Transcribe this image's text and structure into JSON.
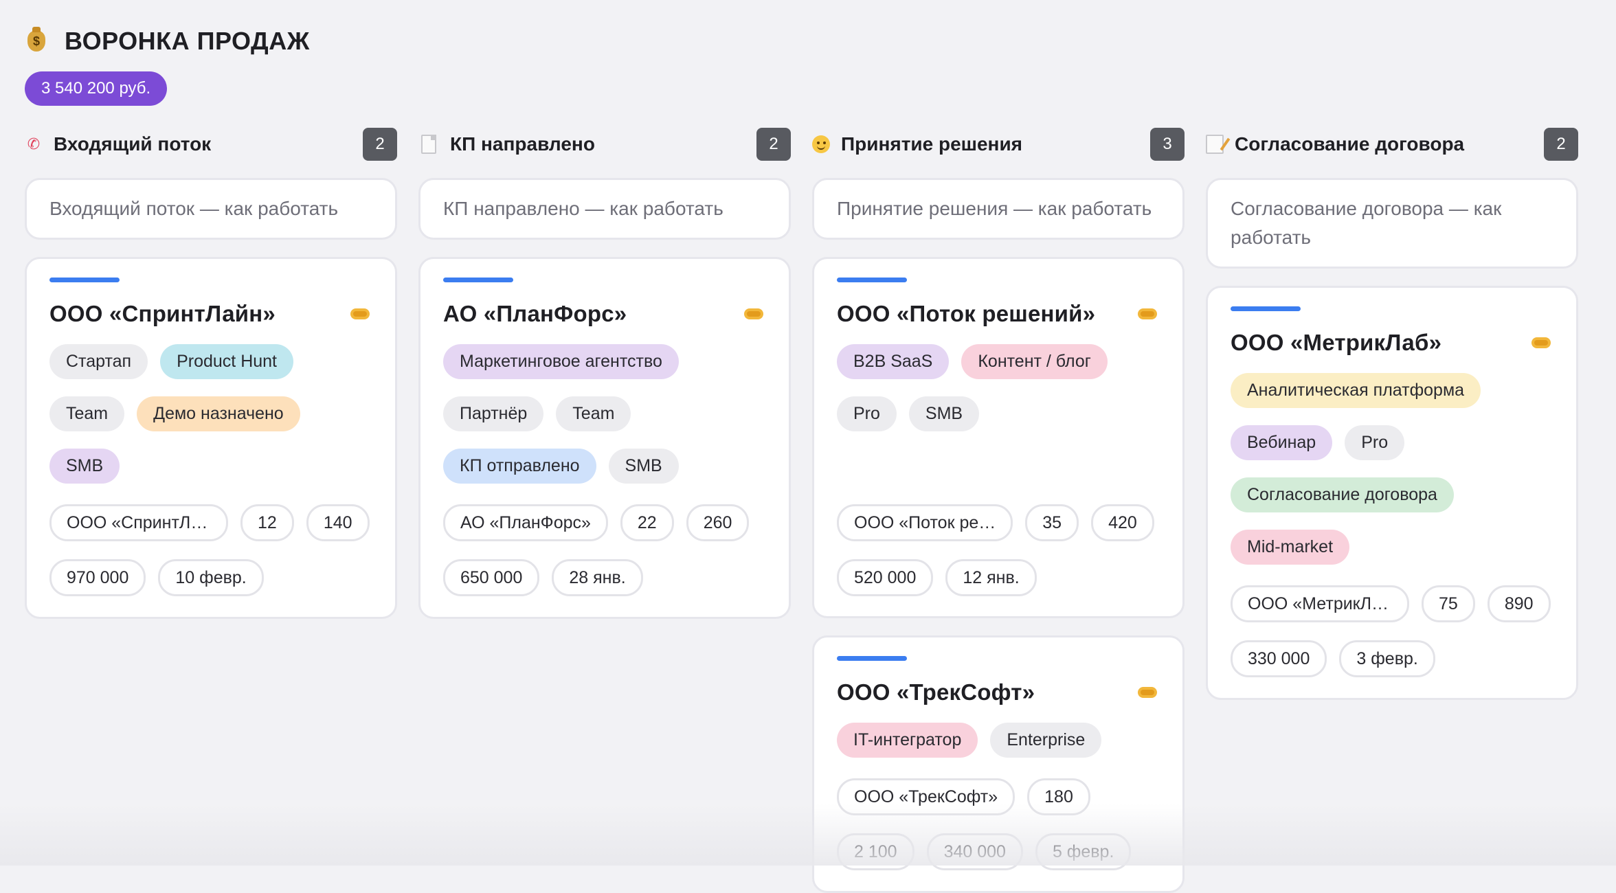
{
  "board": {
    "icon": "money-bag-icon",
    "title": "ВОРОНКА ПРОДАЖ",
    "total": "3 540 200 руб."
  },
  "columns": [
    {
      "icon": "phone-icon",
      "title": "Входящий поток",
      "count": "2",
      "howto": "Входящий поток — как работать",
      "cards": [
        {
          "title": "ООО «СпринтЛайн»",
          "tags": [
            {
              "label": "Стартап",
              "color": "#ececef"
            },
            {
              "label": "Product Hunt",
              "color": "#bfe7ef"
            },
            {
              "label": "Team",
              "color": "#ececef"
            },
            {
              "label": "Демо назначено",
              "color": "#fde0bb"
            },
            {
              "label": "SMB",
              "color": "#e5d6f3"
            }
          ],
          "meta": [
            "ООО «СпринтЛа…",
            "12",
            "140",
            "970 000",
            "10 февр."
          ]
        }
      ]
    },
    {
      "icon": "document-icon",
      "title": "КП направлено",
      "count": "2",
      "howto": "КП направлено — как работать",
      "cards": [
        {
          "title": "АО «ПланФорс»",
          "tags": [
            {
              "label": "Маркетинговое агентство",
              "color": "#e5d6f3"
            },
            {
              "label": "Партнёр",
              "color": "#ececef"
            },
            {
              "label": "Team",
              "color": "#ececef"
            },
            {
              "label": "КП отправлено",
              "color": "#cfe1fb"
            },
            {
              "label": "SMB",
              "color": "#ececef"
            }
          ],
          "meta": [
            "АО «ПланФорс»",
            "22",
            "260",
            "650 000",
            "28 янв."
          ]
        }
      ]
    },
    {
      "icon": "smiley-icon",
      "title": "Принятие решения",
      "count": "3",
      "howto": "Принятие решения — как работать",
      "cards": [
        {
          "title": "ООО «Поток решений»",
          "tags": [
            {
              "label": "B2B SaaS",
              "color": "#e5d6f3"
            },
            {
              "label": "Контент / блог",
              "color": "#f9d1dc"
            },
            {
              "label": "Pro",
              "color": "#ececef"
            },
            {
              "label": "SMB",
              "color": "#ececef"
            }
          ],
          "meta": [
            "ООО «Поток ре…",
            "35",
            "420",
            "520 000",
            "12 янв."
          ]
        },
        {
          "title": "ООО «ТрекСофт»",
          "tags": [
            {
              "label": "IT-интегратор",
              "color": "#f9d1dc"
            },
            {
              "label": "Enterprise",
              "color": "#ececef"
            }
          ],
          "meta": [
            "ООО «ТрекСофт»",
            "180",
            "2 100",
            "340 000",
            "5 февр."
          ]
        }
      ]
    },
    {
      "icon": "memo-icon",
      "title": "Согласование договора",
      "count": "2",
      "howto": "Согласование договора — как работать",
      "cards": [
        {
          "title": "ООО «МетрикЛаб»",
          "tags": [
            {
              "label": "Аналитическая платформа",
              "color": "#fbeec4"
            },
            {
              "label": "Вебинар",
              "color": "#e5d6f3"
            },
            {
              "label": "Pro",
              "color": "#ececef"
            },
            {
              "label": "Согласование договора",
              "color": "#d3ecd8"
            },
            {
              "label": "Mid-market",
              "color": "#f9d1dc"
            }
          ],
          "meta": [
            "ООО «МетрикЛа…",
            "75",
            "890",
            "330 000",
            "3 февр."
          ]
        }
      ]
    }
  ],
  "colors": {
    "accent_bar": "#3b7df0",
    "total_badge": "#7c4bd6",
    "count_badge": "#585a60"
  }
}
